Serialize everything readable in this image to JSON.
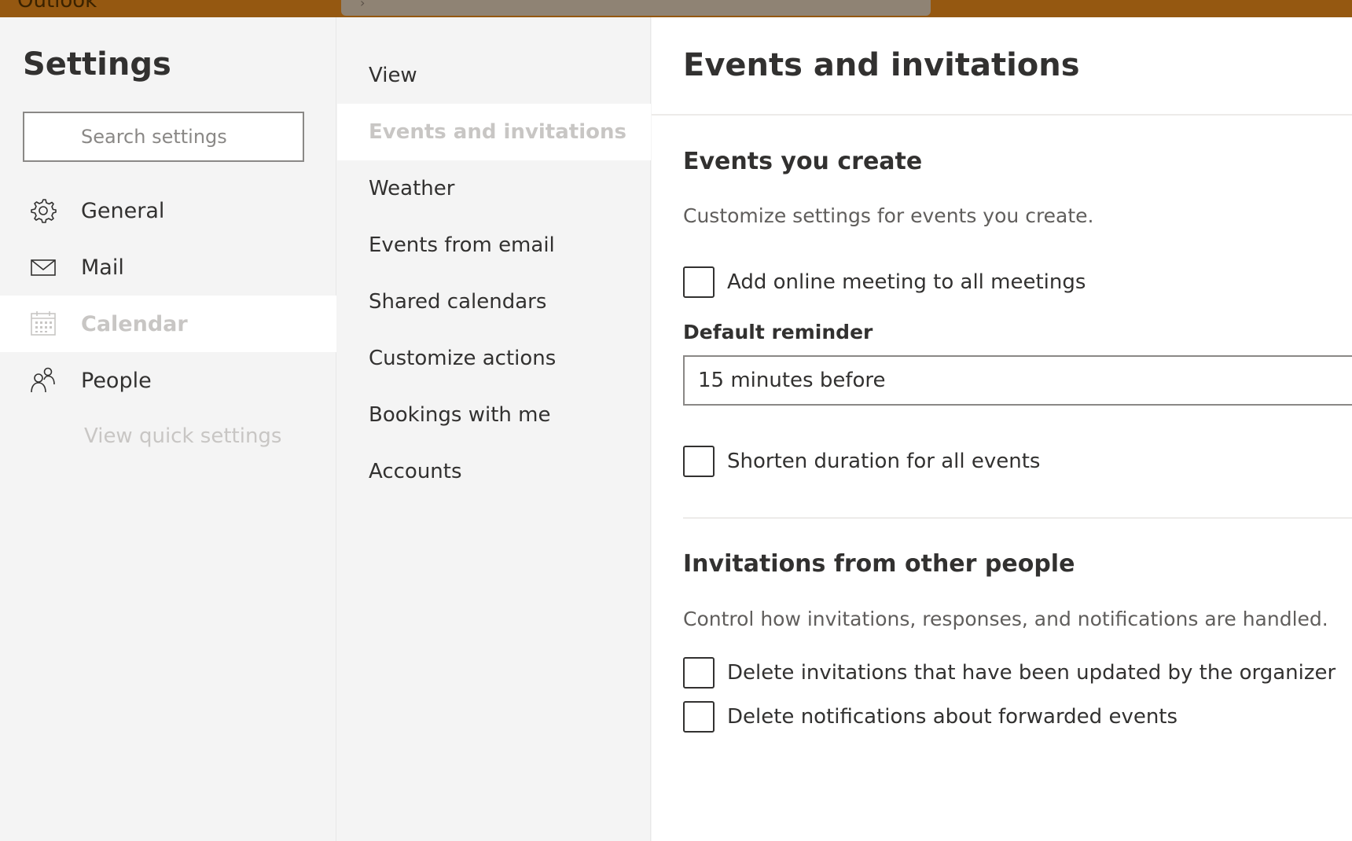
{
  "app": {
    "title": "Outlook",
    "accent": "#955811"
  },
  "settings": {
    "title": "Settings",
    "search_placeholder": "Search settings",
    "nav": [
      {
        "label": "General",
        "icon": "gear-icon",
        "selected": false
      },
      {
        "label": "Mail",
        "icon": "mail-icon",
        "selected": false
      },
      {
        "label": "Calendar",
        "icon": "calendar-icon",
        "selected": true
      },
      {
        "label": "People",
        "icon": "people-icon",
        "selected": false
      }
    ],
    "quick_settings_link": "View quick settings"
  },
  "calendar_menu": {
    "items": [
      {
        "label": "View",
        "selected": false
      },
      {
        "label": "Events and invitations",
        "selected": true
      },
      {
        "label": "Weather",
        "selected": false
      },
      {
        "label": "Events from email",
        "selected": false
      },
      {
        "label": "Shared calendars",
        "selected": false
      },
      {
        "label": "Customize actions",
        "selected": false
      },
      {
        "label": "Bookings with me",
        "selected": false
      },
      {
        "label": "Accounts",
        "selected": false
      }
    ]
  },
  "content": {
    "page_title": "Events and invitations",
    "events_you_create": {
      "title": "Events you create",
      "description": "Customize settings for events you create.",
      "add_online_meeting": {
        "label": "Add online meeting to all meetings",
        "checked": false
      },
      "default_reminder": {
        "label": "Default reminder",
        "value": "15 minutes before"
      },
      "shorten_duration": {
        "label": "Shorten duration for all events",
        "checked": false
      }
    },
    "invitations": {
      "title": "Invitations from other people",
      "description": "Control how invitations, responses, and notifications are handled.",
      "delete_updated": {
        "label": "Delete invitations that have been updated by the organizer",
        "checked": false
      },
      "delete_forwarded": {
        "label": "Delete notifications about forwarded events",
        "checked": false
      }
    }
  }
}
